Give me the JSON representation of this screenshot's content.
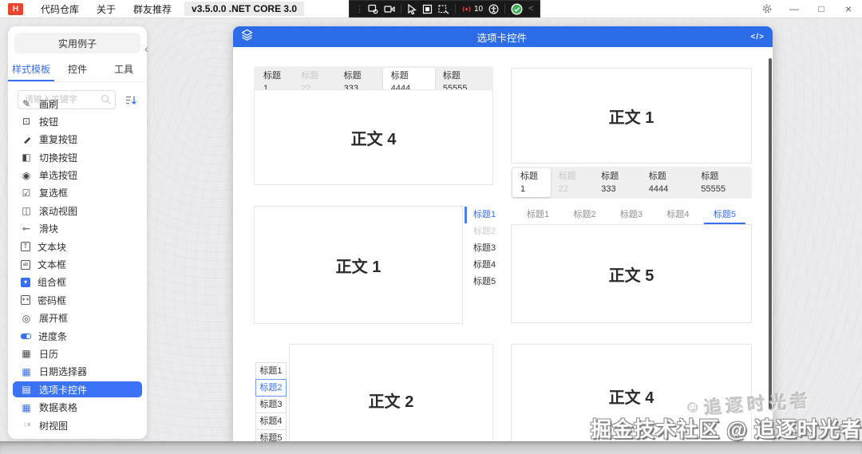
{
  "titlebar": {
    "logo": "H",
    "menus": [
      {
        "label": "代码仓库"
      },
      {
        "label": "关于"
      },
      {
        "label": "群友推荐"
      }
    ],
    "version": "v3.5.0.0 .NET CORE 3.0",
    "overlay": {
      "handle": "⋮",
      "record_count": "10",
      "collapse": "<"
    },
    "window_controls": {
      "minimize": "—",
      "maximize": "□",
      "close": "×"
    }
  },
  "sidebar": {
    "header": "实用例子",
    "collapse": "‹",
    "tabs": [
      {
        "label": "样式模板",
        "cls": "active"
      },
      {
        "label": "控件"
      },
      {
        "label": "工具"
      }
    ],
    "search_placeholder": "请输入关键字",
    "items": [
      {
        "label": "画刷",
        "icon": "✎"
      },
      {
        "label": "按钮",
        "icon": "⊡"
      },
      {
        "label": "重复按钮",
        "icon": "▬",
        "iconCls": "rot45"
      },
      {
        "label": "切换按钮",
        "icon": "◧"
      },
      {
        "label": "单选按钮",
        "icon": "◉"
      },
      {
        "label": "复选框",
        "icon": "☑"
      },
      {
        "label": "滚动视图",
        "icon": "◫"
      },
      {
        "label": "滑块",
        "icon": "⊸",
        "iconCls": "flip"
      },
      {
        "label": "文本块",
        "icon": "T",
        "iconCls": "boxed"
      },
      {
        "label": "文本框",
        "icon": "ab",
        "iconCls": "boxed tiny"
      },
      {
        "label": "组合框",
        "icon": "▾",
        "iconCls": "boxed fillblue"
      },
      {
        "label": "密码框",
        "icon": "∗∗",
        "iconCls": "boxed tiny"
      },
      {
        "label": "展开框",
        "icon": "◎"
      },
      {
        "label": "进度条",
        "icon": "",
        "iconCls": "progress"
      },
      {
        "label": "日历",
        "icon": "▦"
      },
      {
        "label": "日期选择器",
        "icon": "▦",
        "iconCls": "blue"
      },
      {
        "label": "选项卡控件",
        "icon": "▤",
        "cls": "selected"
      },
      {
        "label": "数据表格",
        "icon": "▦",
        "iconCls": "blue"
      },
      {
        "label": "树视图",
        "icon": "⋮≡",
        "iconCls": "tiny"
      }
    ]
  },
  "demo": {
    "title": "选项卡控件",
    "code_label": "</>",
    "panel1": {
      "tabs": [
        {
          "label": "标题1"
        },
        {
          "label": "标题22",
          "cls": "disabled"
        },
        {
          "label": "标题333"
        },
        {
          "label": "标题4444",
          "cls": "selected"
        },
        {
          "label": "标题55555"
        }
      ],
      "content": "正文 4"
    },
    "panel2": {
      "tabs": [
        {
          "label": "标题1",
          "cls": "selected"
        },
        {
          "label": "标题22",
          "cls": "disabled"
        },
        {
          "label": "标题333"
        },
        {
          "label": "标题4444"
        },
        {
          "label": "标题55555"
        }
      ],
      "content": "正文 1"
    },
    "panel3": {
      "tabs": [
        {
          "label": "标题1",
          "cls": "selected"
        },
        {
          "label": "标题2",
          "cls": "disabled"
        },
        {
          "label": "标题3"
        },
        {
          "label": "标题4"
        },
        {
          "label": "标题5"
        }
      ],
      "content": "正文 1"
    },
    "panel4": {
      "tabs": [
        {
          "label": "标题1"
        },
        {
          "label": "标题2"
        },
        {
          "label": "标题3"
        },
        {
          "label": "标题4"
        },
        {
          "label": "标题5",
          "cls": "selected"
        }
      ],
      "content": "正文 5"
    },
    "panel5": {
      "tabs": [
        {
          "label": "标题1"
        },
        {
          "label": "标题2",
          "cls": "selected"
        },
        {
          "label": "标题3"
        },
        {
          "label": "标题4"
        },
        {
          "label": "标题5"
        }
      ],
      "content": "正文 2"
    },
    "panel6": {
      "content": "正文 4"
    }
  },
  "watermark": {
    "main": "掘金技术社区 @ 追逐时光者",
    "stamp": "追逐时光者",
    "smiley": "☺"
  }
}
